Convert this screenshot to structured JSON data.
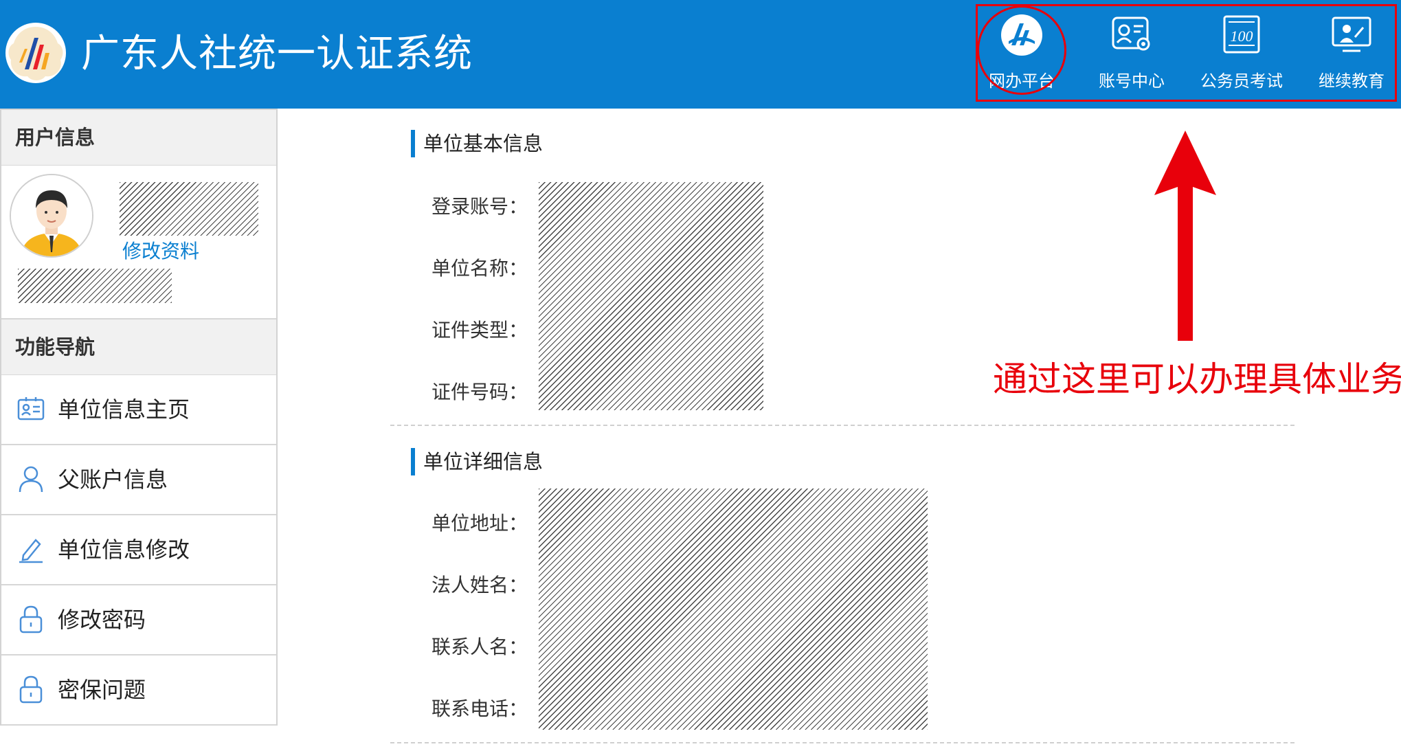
{
  "header": {
    "title": "广东人社统一认证系统",
    "colors": {
      "bar": "#0a7fd0",
      "highlight": "#e8000b"
    },
    "nav": [
      {
        "label": "网办平台",
        "icon": "portal-logo-icon"
      },
      {
        "label": "账号中心",
        "icon": "account-center-icon"
      },
      {
        "label": "公务员考试",
        "icon": "exam-icon"
      },
      {
        "label": "继续教育",
        "icon": "education-icon"
      }
    ]
  },
  "sidebar": {
    "user_heading": "用户信息",
    "edit_profile": "修改资料",
    "nav_heading": "功能导航",
    "items": [
      {
        "label": "单位信息主页",
        "icon": "id-card-icon"
      },
      {
        "label": "父账户信息",
        "icon": "user-icon"
      },
      {
        "label": "单位信息修改",
        "icon": "pencil-icon"
      },
      {
        "label": "修改密码",
        "icon": "lock-icon"
      },
      {
        "label": "密保问题",
        "icon": "lock-icon"
      }
    ]
  },
  "main": {
    "basic": {
      "title": "单位基本信息",
      "fields": [
        "登录账号：",
        "单位名称：",
        "证件类型：",
        "证件号码："
      ]
    },
    "detail": {
      "title": "单位详细信息",
      "fields": [
        "单位地址：",
        "法人姓名：",
        "联系人名：",
        "联系电话："
      ]
    }
  },
  "annotation": {
    "text": "通过这里可以办理具体业务"
  }
}
